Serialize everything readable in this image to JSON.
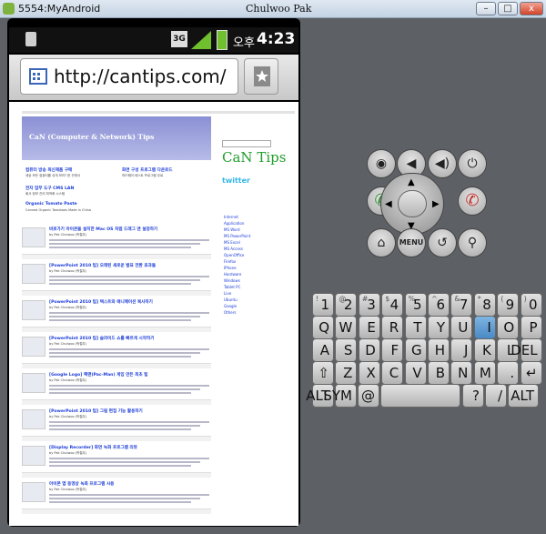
{
  "window": {
    "title": "5554:MyAndroid",
    "center_title": "Chulwoo Pak",
    "min_label": "–",
    "max_label": "□",
    "close_label": "x"
  },
  "status_bar": {
    "network": "3G",
    "ampm": "오후",
    "time": "4:23"
  },
  "browser": {
    "url": "http://cantips.com/"
  },
  "blog": {
    "title": "CaN (Computer & Network) Tips",
    "sidebar_logo": "CaN Tips",
    "twitter": "twitter",
    "ads": [
      {
        "title": "컴퓨터 방송 최신제품 구매",
        "text": "세상 모든 컴퓨터를 쉬게 보라? 한 곳에서"
      },
      {
        "title": "화면 구성 프로그램 다운로드",
        "text": "하드웨어 테스트 프로그램 무료"
      },
      {
        "title": "전자 업무 도구 CMS LAN",
        "text": "회사 정보 관리 최적화 시스템"
      },
      {
        "title": "Organic Tomato Paste",
        "text": "Canned Organic Tomatoes Made in China"
      }
    ],
    "posts": [
      {
        "title": "바로가기 아이콘을 설치한 Mac OS 처럼 드래그 앤 설정하기",
        "meta": "by Pak Chulwoo (박철우)"
      },
      {
        "title": "[PowerPoint 2010 팁] 오래된 새로운 발표 전환 효과들",
        "meta": "by Pak Chulwoo (박철우)"
      },
      {
        "title": "[PowerPoint 2010 팁] 텍스트와 애니메이션 복사하기",
        "meta": "by Pak Chulwoo (박철우)"
      },
      {
        "title": "[PowerPoint 2010 팁] 슬라이드 쇼를 빠르게 시작하기",
        "meta": "by Pak Chulwoo (박철우)"
      },
      {
        "title": "[Google Logo] 팩맨(Pac-Man) 게임 만든 최초 팁",
        "meta": "by Pak Chulwoo (박철우)"
      },
      {
        "title": "[PowerPoint 2010 팁] 그림 편집 기능 활용하기",
        "meta": "by Pak Chulwoo (박철우)"
      },
      {
        "title": "[Display Recorder] 화면 녹화 프로그램 리뷰",
        "meta": "by Pak Chulwoo (박철우)"
      },
      {
        "title": "아이폰 앱 동영상 녹화 프로그램 사용",
        "meta": "by Pak Chulwoo (박철우)"
      }
    ],
    "sidebar_links": [
      "Internet",
      "Application",
      "MS Word",
      "MS PowerPoint",
      "MS Excel",
      "MS Access",
      "OpenOffice",
      "Firefox",
      "IPhone",
      "Hardware",
      "Windows",
      "Tablet PC",
      "Live",
      "Ubuntu",
      "Google",
      "Others"
    ]
  },
  "keyboard": {
    "row1": [
      {
        "sub": "!",
        "main": "1"
      },
      {
        "sub": "@",
        "main": "2"
      },
      {
        "sub": "#",
        "main": "3"
      },
      {
        "sub": "$",
        "main": "4"
      },
      {
        "sub": "%",
        "main": "5"
      },
      {
        "sub": "^",
        "main": "6"
      },
      {
        "sub": "&",
        "main": "7"
      },
      {
        "sub": "*",
        "main": "8"
      },
      {
        "sub": "(",
        "main": "9"
      },
      {
        "sub": ")",
        "main": "0"
      }
    ],
    "row2": [
      "Q",
      "W",
      "E",
      "R",
      "T",
      "Y",
      "U",
      "I",
      "O",
      "P"
    ],
    "row3": [
      "A",
      "S",
      "D",
      "F",
      "G",
      "H",
      "J",
      "K",
      "L",
      "DEL"
    ],
    "row4": [
      "⇧",
      "Z",
      "X",
      "C",
      "V",
      "B",
      "N",
      "M",
      ".",
      "↵"
    ],
    "row5": [
      "ALT",
      "SYM",
      "@",
      "",
      "",
      "?",
      "/",
      "ALT"
    ],
    "controls": {
      "menu": "MENU"
    }
  },
  "colors": {
    "accent": "#1a3bd8",
    "status_bar": "#111111",
    "key_highlight": "#5b9bd5",
    "call_green": "#2e8b2e",
    "end_red": "#c0302a"
  }
}
